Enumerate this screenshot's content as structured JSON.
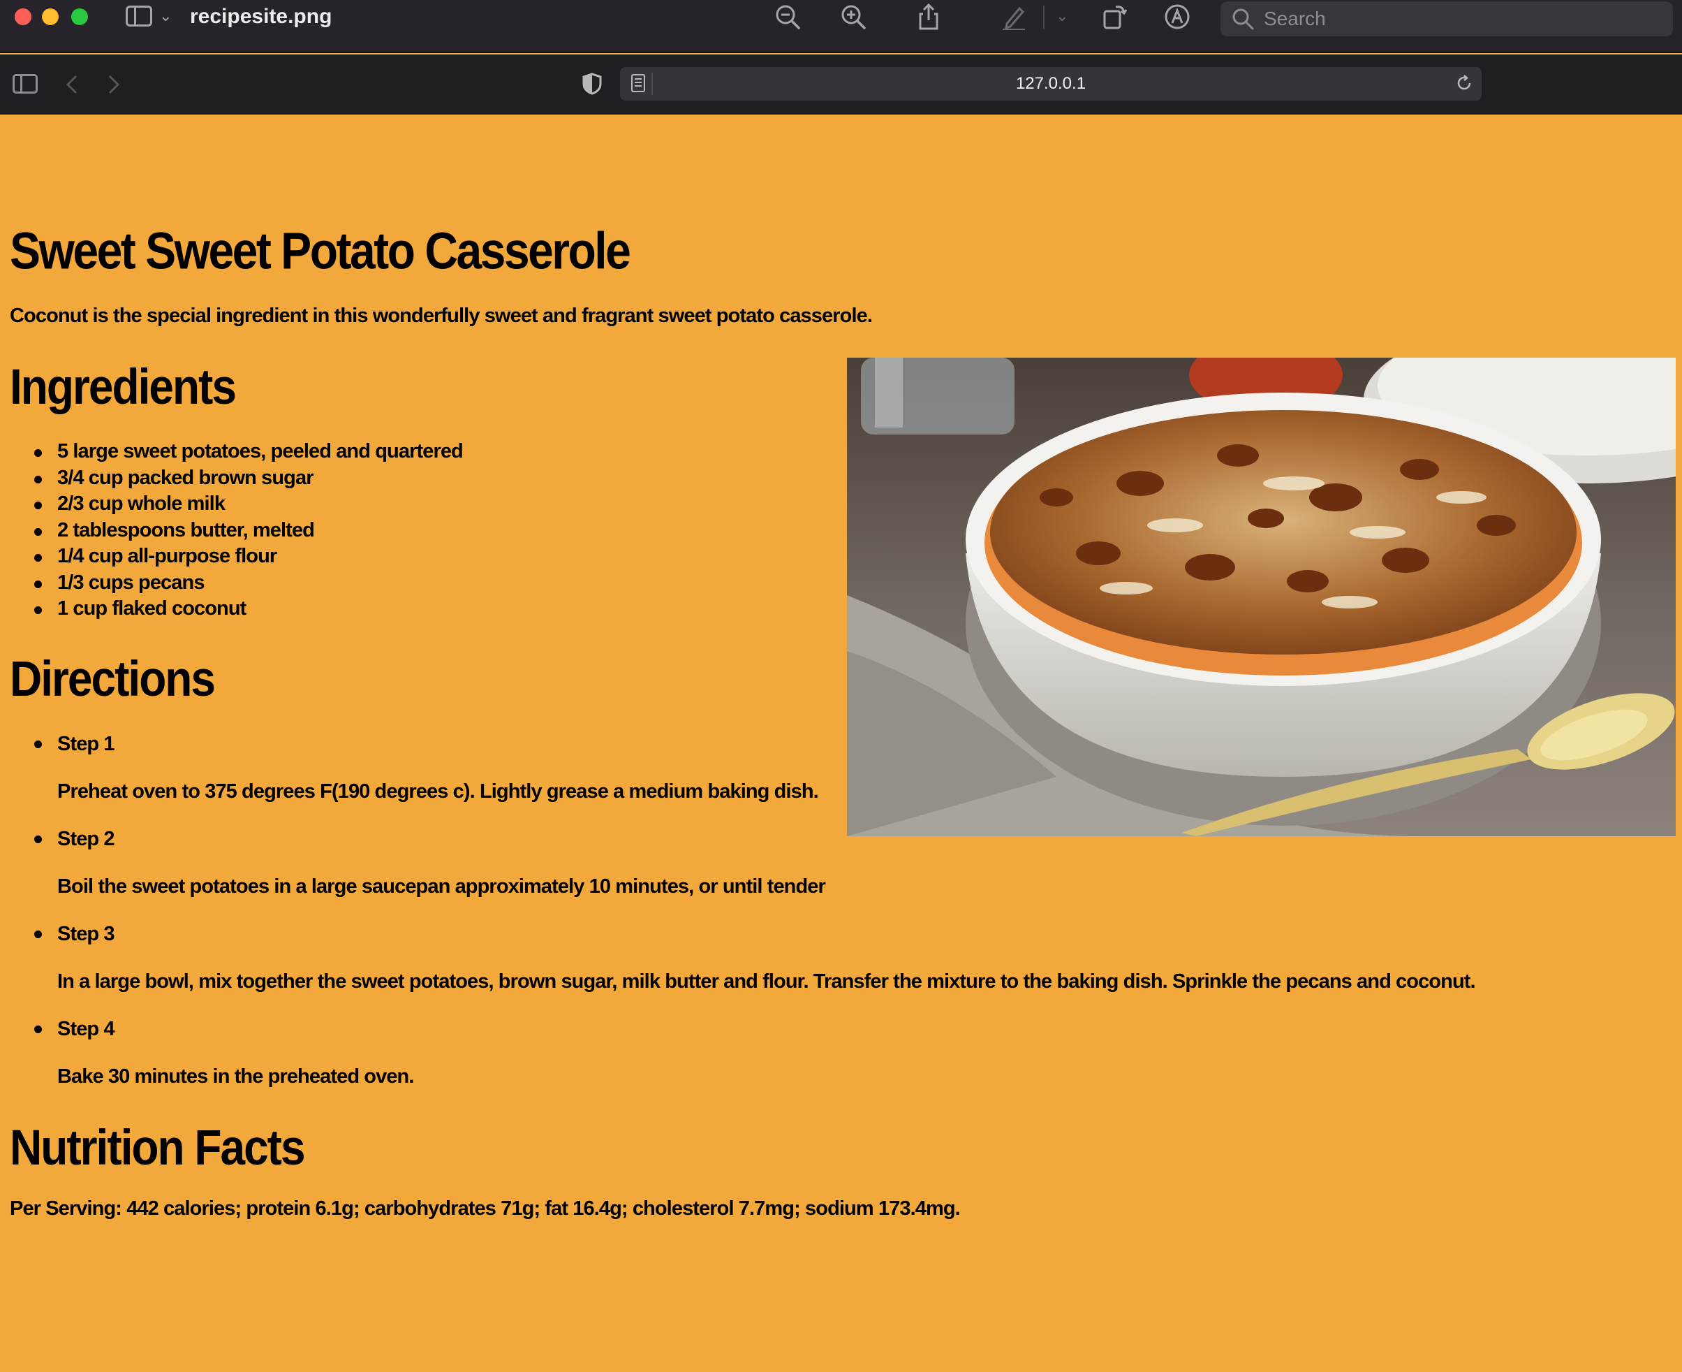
{
  "window": {
    "title": "recipesite.png",
    "search_placeholder": "Search",
    "url": "127.0.0.1"
  },
  "recipe": {
    "title": "Sweet Sweet Potato Casserole",
    "intro": "Coconut is the special ingredient in this wonderfully sweet and fragrant sweet potato casserole.",
    "ingredients_heading": "Ingredients",
    "ingredients": [
      "5 large sweet potatoes, peeled and quartered",
      "3/4 cup packed brown sugar",
      "2/3 cup whole milk",
      "2 tablespoons butter, melted",
      "1/4 cup all-purpose flour",
      "1/3 cups pecans",
      "1 cup flaked coconut"
    ],
    "directions_heading": "Directions",
    "steps": [
      {
        "title": "Step 1",
        "text": "Preheat oven to 375 degrees F(190 degrees c). Lightly grease a medium baking dish."
      },
      {
        "title": "Step 2",
        "text": "Boil the sweet potatoes in a large saucepan approximately 10 minutes, or until tender"
      },
      {
        "title": "Step 3",
        "text": "In a large bowl, mix together the sweet potatoes, brown sugar, milk butter and flour. Transfer the mixture to the baking dish. Sprinkle the pecans and coconut."
      },
      {
        "title": "Step 4",
        "text": "Bake 30 minutes in the preheated oven."
      }
    ],
    "nutrition_heading": "Nutrition Facts",
    "nutrition": "Per Serving: 442 calories; protein 6.1g; carbohydrates 71g; fat 16.4g; cholesterol 7.7mg; sodium 173.4mg."
  },
  "colors": {
    "page_background": "#f3a83c",
    "titlebar": "#26242a",
    "toolbar": "#1f1e22"
  },
  "icons": [
    "zoom-out-icon",
    "zoom-in-icon",
    "share-icon",
    "markup-icon",
    "rotate-icon",
    "annotate-icon",
    "search-icon",
    "sidebar-icon",
    "back-icon",
    "forward-icon",
    "privacy-shield-icon",
    "reader-icon",
    "reload-icon"
  ]
}
